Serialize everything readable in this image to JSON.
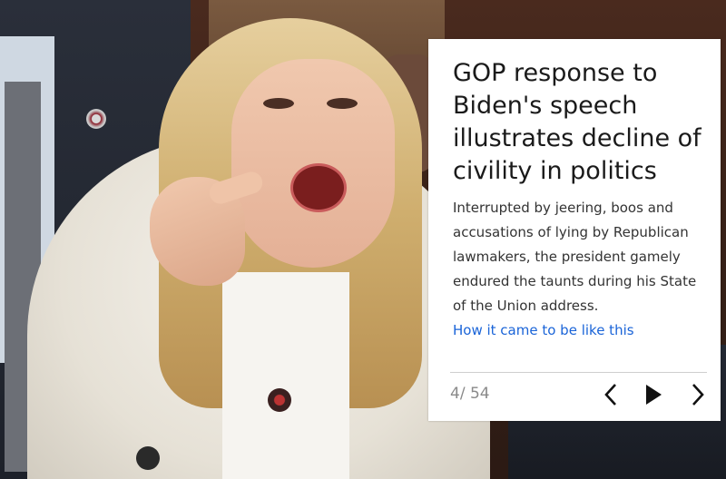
{
  "slide": {
    "title": "GOP response to Biden's speech illustrates decline of civility in politics",
    "description": "Interrupted by jeering, boos and accusations of lying by Republican lawmakers, the president gamely endured the taunts during his State of the Union address.",
    "link_text": "How it came to be like this",
    "counter": "4/ 54",
    "controls": {
      "prev_icon": "chevron-left-icon",
      "play_icon": "play-icon",
      "next_icon": "chevron-right-icon"
    }
  },
  "colors": {
    "link": "#1a64d8",
    "counter": "#8a8a8a",
    "card_bg": "#ffffff"
  }
}
